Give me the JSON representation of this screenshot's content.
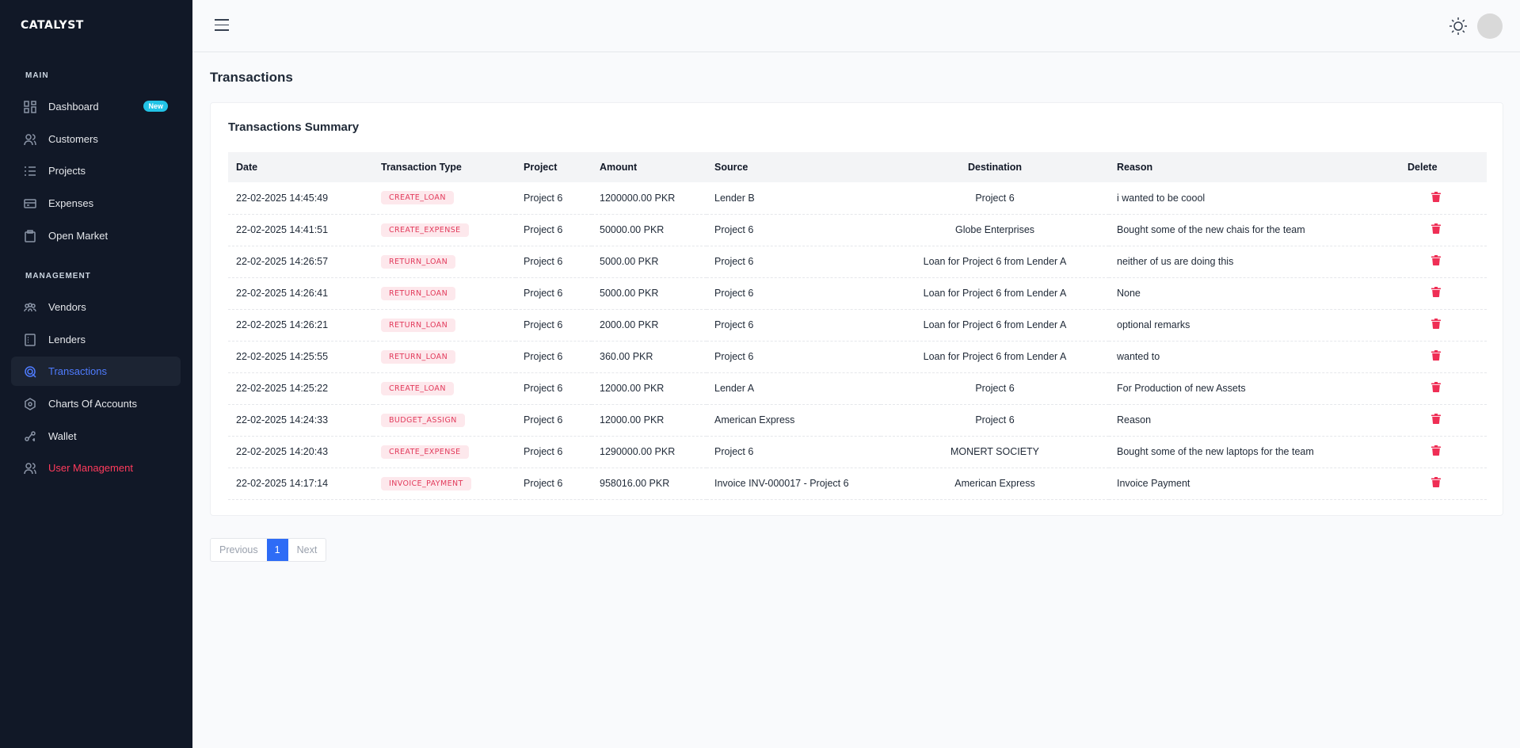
{
  "app": {
    "logo": "CATALYST"
  },
  "sidebar": {
    "main_label": "MAIN",
    "management_label": "MANAGEMENT",
    "main_items": [
      {
        "label": "Dashboard",
        "icon": "dashboard-icon",
        "badge": "New"
      },
      {
        "label": "Customers",
        "icon": "users-icon"
      },
      {
        "label": "Projects",
        "icon": "list-icon"
      },
      {
        "label": "Expenses",
        "icon": "card-icon"
      },
      {
        "label": "Open Market",
        "icon": "clipboard-icon"
      }
    ],
    "management_items": [
      {
        "label": "Vendors",
        "icon": "vendors-icon"
      },
      {
        "label": "Lenders",
        "icon": "ledger-icon"
      },
      {
        "label": "Transactions",
        "icon": "transactions-icon",
        "active": true
      },
      {
        "label": "Charts Of Accounts",
        "icon": "hexagon-icon"
      },
      {
        "label": "Wallet",
        "icon": "wallet-icon"
      },
      {
        "label": "User Management",
        "icon": "user-group-icon",
        "color": "#ff3b5c"
      }
    ]
  },
  "colors": {
    "accent": "#2e6cf6",
    "danger": "#ef2e55",
    "sidebar_bg": "#111827",
    "pill_bg": "#fde8ec",
    "pill_text": "#e23a5b"
  },
  "page": {
    "title": "Transactions"
  },
  "card": {
    "title": "Transactions Summary",
    "columns": [
      "Date",
      "Transaction Type",
      "Project",
      "Amount",
      "Source",
      "Destination",
      "Reason",
      "Delete"
    ],
    "rows": [
      {
        "date": "22-02-2025 14:45:49",
        "type": "CREATE_LOAN",
        "project": "Project 6",
        "amount": "1200000.00 PKR",
        "source": "Lender B",
        "destination": "Project 6",
        "reason": "i wanted to be coool"
      },
      {
        "date": "22-02-2025 14:41:51",
        "type": "CREATE_EXPENSE",
        "project": "Project 6",
        "amount": "50000.00 PKR",
        "source": "Project 6",
        "destination": "Globe Enterprises",
        "reason": "Bought some of the new chais for the team"
      },
      {
        "date": "22-02-2025 14:26:57",
        "type": "RETURN_LOAN",
        "project": "Project 6",
        "amount": "5000.00 PKR",
        "source": "Project 6",
        "destination": "Loan for Project 6 from Lender A",
        "reason": "neither of us are doing this"
      },
      {
        "date": "22-02-2025 14:26:41",
        "type": "RETURN_LOAN",
        "project": "Project 6",
        "amount": "5000.00 PKR",
        "source": "Project 6",
        "destination": "Loan for Project 6 from Lender A",
        "reason": "None"
      },
      {
        "date": "22-02-2025 14:26:21",
        "type": "RETURN_LOAN",
        "project": "Project 6",
        "amount": "2000.00 PKR",
        "source": "Project 6",
        "destination": "Loan for Project 6 from Lender A",
        "reason": "optional remarks"
      },
      {
        "date": "22-02-2025 14:25:55",
        "type": "RETURN_LOAN",
        "project": "Project 6",
        "amount": "360.00 PKR",
        "source": "Project 6",
        "destination": "Loan for Project 6 from Lender A",
        "reason": "wanted to"
      },
      {
        "date": "22-02-2025 14:25:22",
        "type": "CREATE_LOAN",
        "project": "Project 6",
        "amount": "12000.00 PKR",
        "source": "Lender A",
        "destination": "Project 6",
        "reason": "For Production of new Assets"
      },
      {
        "date": "22-02-2025 14:24:33",
        "type": "BUDGET_ASSIGN",
        "project": "Project 6",
        "amount": "12000.00 PKR",
        "source": "American Express",
        "destination": "Project 6",
        "reason": "Reason"
      },
      {
        "date": "22-02-2025 14:20:43",
        "type": "CREATE_EXPENSE",
        "project": "Project 6",
        "amount": "1290000.00 PKR",
        "source": "Project 6",
        "destination": "MONERT SOCIETY",
        "reason": "Bought some of the new laptops for the team"
      },
      {
        "date": "22-02-2025 14:17:14",
        "type": "INVOICE_PAYMENT",
        "project": "Project 6",
        "amount": "958016.00 PKR",
        "source": "Invoice INV-000017 - Project 6",
        "destination": "American Express",
        "reason": "Invoice Payment"
      }
    ]
  },
  "pagination": {
    "previous": "Previous",
    "current": "1",
    "next": "Next"
  }
}
